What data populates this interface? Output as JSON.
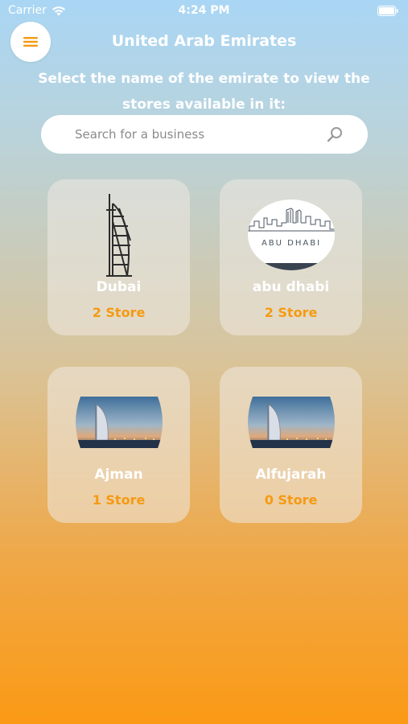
{
  "status_bar": {
    "carrier": "Carrier",
    "time": "4:24 PM"
  },
  "header": {
    "title": "United Arab Emirates"
  },
  "subtitle": "Select the name of the emirate to view the stores available in it:",
  "search": {
    "placeholder": "Search for a business"
  },
  "emirates": [
    {
      "name": "Dubai",
      "count": "2 Store",
      "image": "burj-al-arab-line-drawing"
    },
    {
      "name": "abu dhabi",
      "count": "2 Store",
      "image": "abu-dhabi-skyline-logo",
      "logo_text": "ABU DHABI"
    },
    {
      "name": "Ajman",
      "count": "1 Store",
      "image": "burj-al-arab-sunset-photo"
    },
    {
      "name": "Alfujarah",
      "count": "0 Store",
      "image": "burj-al-arab-sunset-photo"
    }
  ],
  "colors": {
    "accent": "#f59a12",
    "gradient_top": "#a9d6f5",
    "gradient_bottom": "#fb9a15"
  },
  "icons": {
    "menu": "hamburger-icon",
    "search": "search-icon",
    "wifi": "wifi-icon",
    "battery": "battery-icon"
  }
}
